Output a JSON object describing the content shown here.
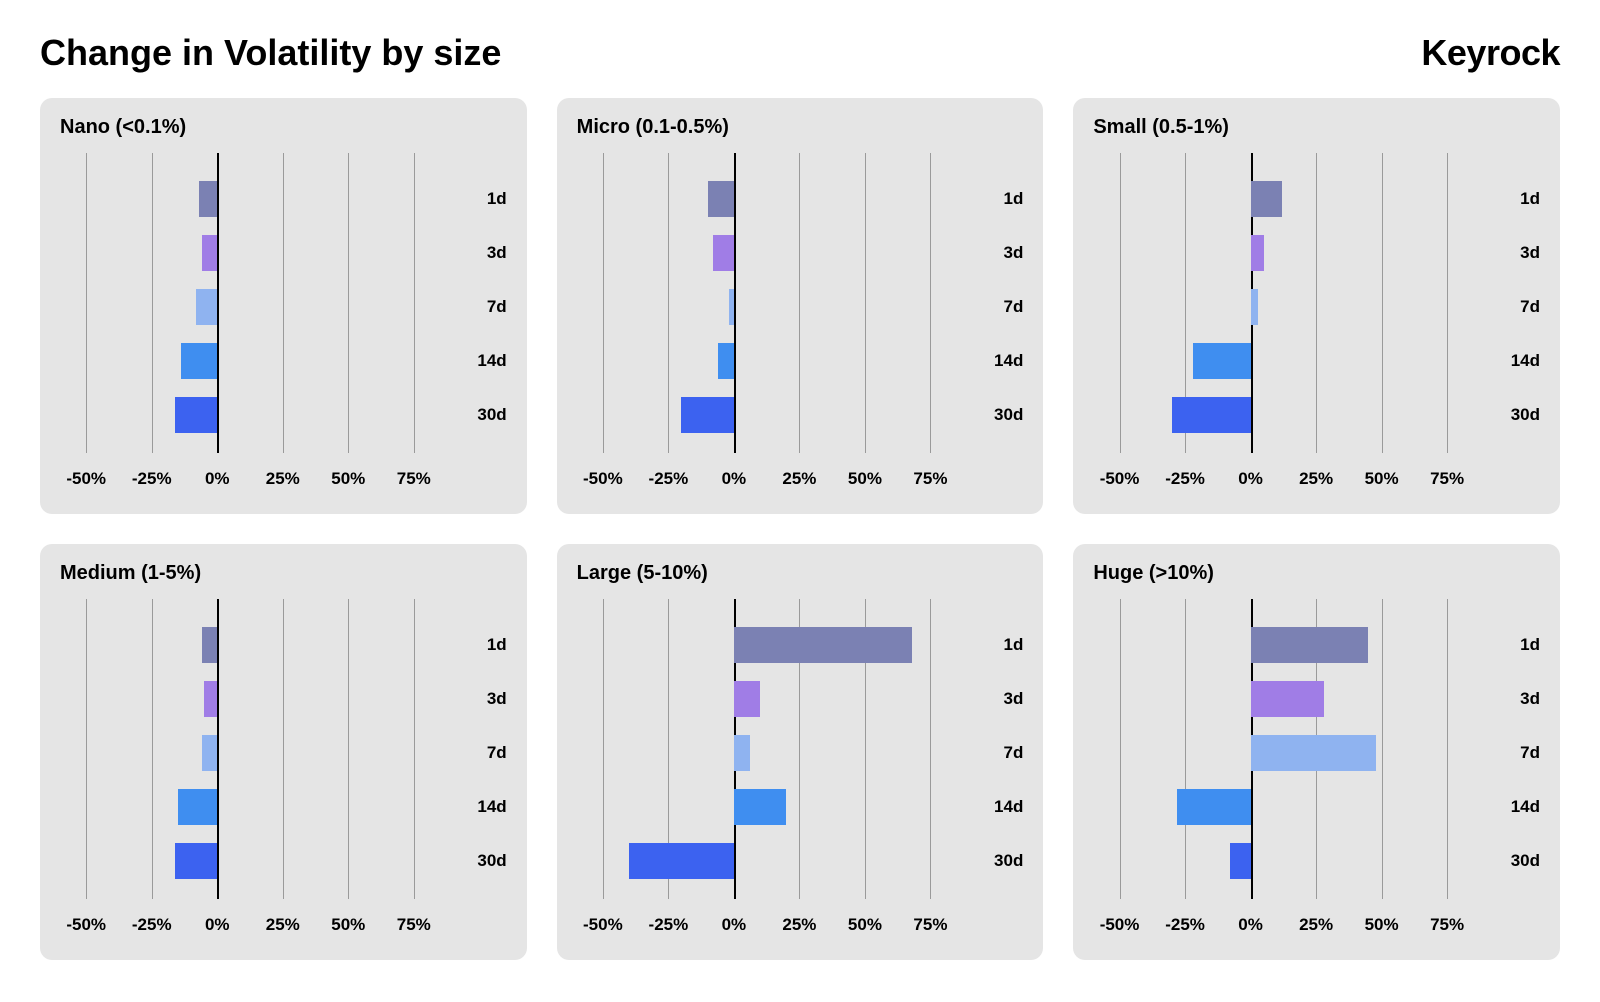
{
  "header": {
    "title": "Change in Volatility by size",
    "brand": "Keyrock"
  },
  "axis": {
    "ticks": [
      -50,
      -25,
      0,
      25,
      50,
      75
    ],
    "tick_labels": [
      "-50%",
      "-25%",
      "0%",
      "25%",
      "50%",
      "75%"
    ],
    "xmin": -60,
    "xmax": 85
  },
  "bar_colors": [
    "#7b81b3",
    "#a07de6",
    "#8fb3f0",
    "#3f8ef0",
    "#3c62f0"
  ],
  "chart_data": [
    {
      "title": "Nano (<0.1%)",
      "type": "bar",
      "categories": [
        "1d",
        "3d",
        "7d",
        "14d",
        "30d"
      ],
      "values": [
        -7,
        -6,
        -8,
        -14,
        -16
      ],
      "xlabel": "",
      "ylabel": "",
      "xlim": [
        -60,
        85
      ]
    },
    {
      "title": "Micro (0.1-0.5%)",
      "type": "bar",
      "categories": [
        "1d",
        "3d",
        "7d",
        "14d",
        "30d"
      ],
      "values": [
        -10,
        -8,
        -2,
        -6,
        -20
      ],
      "xlabel": "",
      "ylabel": "",
      "xlim": [
        -60,
        85
      ]
    },
    {
      "title": "Small (0.5-1%)",
      "type": "bar",
      "categories": [
        "1d",
        "3d",
        "7d",
        "14d",
        "30d"
      ],
      "values": [
        12,
        5,
        3,
        -22,
        -30
      ],
      "xlabel": "",
      "ylabel": "",
      "xlim": [
        -60,
        85
      ]
    },
    {
      "title": "Medium (1-5%)",
      "type": "bar",
      "categories": [
        "1d",
        "3d",
        "7d",
        "14d",
        "30d"
      ],
      "values": [
        -6,
        -5,
        -6,
        -15,
        -16
      ],
      "xlabel": "",
      "ylabel": "",
      "xlim": [
        -60,
        85
      ]
    },
    {
      "title": "Large (5-10%)",
      "type": "bar",
      "categories": [
        "1d",
        "3d",
        "7d",
        "14d",
        "30d"
      ],
      "values": [
        68,
        10,
        6,
        20,
        -40
      ],
      "xlabel": "",
      "ylabel": "",
      "xlim": [
        -60,
        85
      ]
    },
    {
      "title": "Huge (>10%)",
      "type": "bar",
      "categories": [
        "1d",
        "3d",
        "7d",
        "14d",
        "30d"
      ],
      "values": [
        45,
        28,
        48,
        -28,
        -8
      ],
      "xlabel": "",
      "ylabel": "",
      "xlim": [
        -60,
        85
      ]
    }
  ]
}
